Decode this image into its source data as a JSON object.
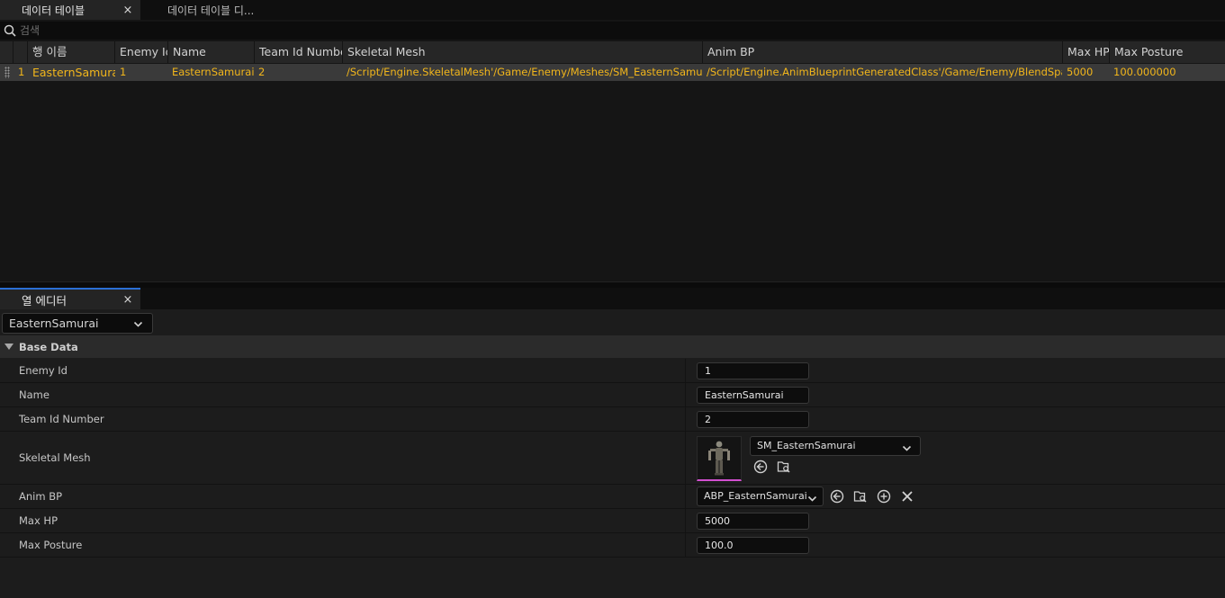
{
  "tabs": {
    "data_table": "데이터 테이블",
    "data_table_diff": "데이터 테이블 디...",
    "close_glyph": "×"
  },
  "search": {
    "placeholder": "검색"
  },
  "table": {
    "columns": [
      "행 이름",
      "Enemy Id",
      "Name",
      "Team Id Number",
      "Skeletal Mesh",
      "Anim BP",
      "Max HP",
      "Max Posture"
    ],
    "rows": [
      {
        "index": "1",
        "row_name": "EasternSamurai",
        "enemy_id": "1",
        "name": "EasternSamurai",
        "team_id_number": "2",
        "skeletal_mesh": "/Script/Engine.SkeletalMesh'/Game/Enemy/Meshes/SM_EasternSamurai",
        "anim_bp": "/Script/Engine.AnimBlueprintGeneratedClass'/Game/Enemy/BlendSpace",
        "max_hp": "5000",
        "max_posture": "100.000000"
      }
    ]
  },
  "row_editor": {
    "tab_label": "열 에디터",
    "selected_row": "EasternSamurai",
    "category": "Base Data",
    "properties": {
      "enemy_id": {
        "label": "Enemy Id",
        "value": "1"
      },
      "name": {
        "label": "Name",
        "value": "EasternSamurai"
      },
      "team_id_number": {
        "label": "Team Id Number",
        "value": "2"
      },
      "skeletal_mesh": {
        "label": "Skeletal Mesh",
        "value": "SM_EasternSamurai"
      },
      "anim_bp": {
        "label": "Anim BP",
        "value": "ABP_EasternSamurai"
      },
      "max_hp": {
        "label": "Max HP",
        "value": "5000"
      },
      "max_posture": {
        "label": "Max Posture",
        "value": "100.0"
      }
    }
  },
  "icons": {
    "search": "search-icon",
    "chevron": "chevron-down-icon",
    "use_selected": "use-selected-asset-icon",
    "browse": "browse-asset-icon",
    "add": "add-icon",
    "clear": "clear-icon"
  },
  "colors": {
    "row_text": "#f2b61b",
    "selected_row_bg": "#3a3a3a",
    "active_tab_accent": "#2b6fd6",
    "thumbnail_accent": "#d24fd0"
  }
}
